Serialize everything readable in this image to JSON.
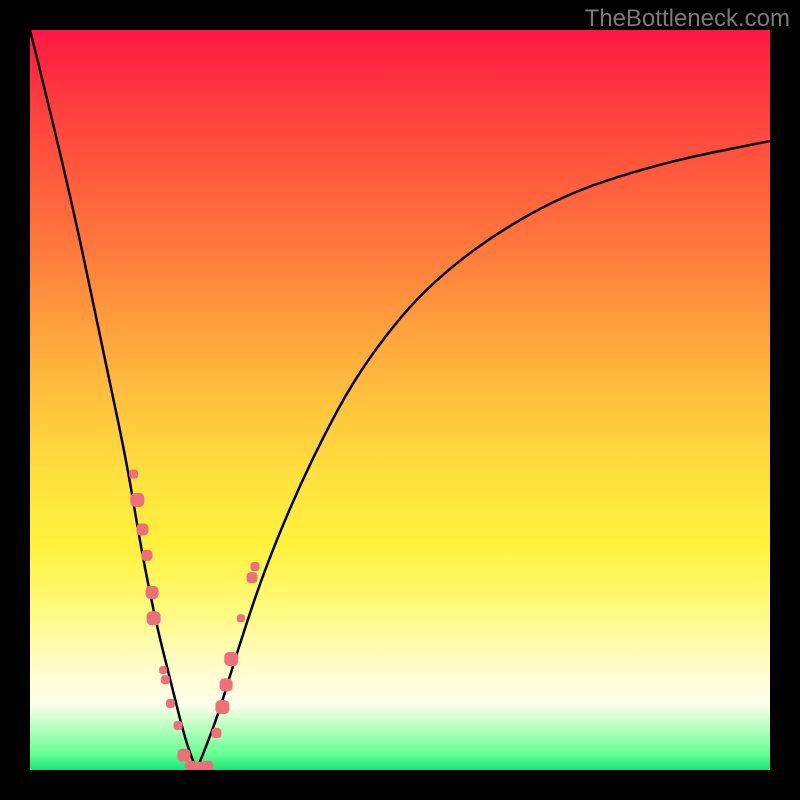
{
  "watermark": "TheBottleneck.com",
  "chart_data": {
    "type": "line",
    "title": "",
    "xlabel": "",
    "ylabel": "",
    "description": "V-shaped bottleneck curve with minimum near x=0.225 (normalized), representing optimal hardware matching where bottleneck approaches zero. Background gradient from red (high bottleneck) at top through yellow to green (low bottleneck) at bottom.",
    "curve": {
      "left_branch": [
        {
          "x": 0.0,
          "y": 1.0
        },
        {
          "x": 0.05,
          "y": 0.8
        },
        {
          "x": 0.1,
          "y": 0.56
        },
        {
          "x": 0.13,
          "y": 0.42
        },
        {
          "x": 0.15,
          "y": 0.3
        },
        {
          "x": 0.17,
          "y": 0.2
        },
        {
          "x": 0.19,
          "y": 0.12
        },
        {
          "x": 0.21,
          "y": 0.04
        },
        {
          "x": 0.225,
          "y": 0.0
        }
      ],
      "right_branch": [
        {
          "x": 0.225,
          "y": 0.0
        },
        {
          "x": 0.25,
          "y": 0.06
        },
        {
          "x": 0.28,
          "y": 0.16
        },
        {
          "x": 0.32,
          "y": 0.28
        },
        {
          "x": 0.38,
          "y": 0.42
        },
        {
          "x": 0.45,
          "y": 0.55
        },
        {
          "x": 0.55,
          "y": 0.67
        },
        {
          "x": 0.7,
          "y": 0.77
        },
        {
          "x": 0.85,
          "y": 0.82
        },
        {
          "x": 1.0,
          "y": 0.85
        }
      ]
    },
    "data_points": [
      {
        "x": 0.14,
        "y": 0.4,
        "size": 9
      },
      {
        "x": 0.145,
        "y": 0.365,
        "size": 14
      },
      {
        "x": 0.152,
        "y": 0.325,
        "size": 12
      },
      {
        "x": 0.158,
        "y": 0.29,
        "size": 11
      },
      {
        "x": 0.165,
        "y": 0.24,
        "size": 13
      },
      {
        "x": 0.167,
        "y": 0.205,
        "size": 14
      },
      {
        "x": 0.18,
        "y": 0.135,
        "size": 8
      },
      {
        "x": 0.183,
        "y": 0.122,
        "size": 9
      },
      {
        "x": 0.19,
        "y": 0.09,
        "size": 9
      },
      {
        "x": 0.2,
        "y": 0.06,
        "size": 9
      },
      {
        "x": 0.208,
        "y": 0.02,
        "size": 13
      },
      {
        "x": 0.217,
        "y": 0.005,
        "size": 11
      },
      {
        "x": 0.23,
        "y": 0.003,
        "size": 12
      },
      {
        "x": 0.24,
        "y": 0.005,
        "size": 11
      },
      {
        "x": 0.252,
        "y": 0.05,
        "size": 10
      },
      {
        "x": 0.26,
        "y": 0.085,
        "size": 14
      },
      {
        "x": 0.265,
        "y": 0.115,
        "size": 13
      },
      {
        "x": 0.272,
        "y": 0.15,
        "size": 14
      },
      {
        "x": 0.285,
        "y": 0.205,
        "size": 8
      },
      {
        "x": 0.3,
        "y": 0.26,
        "size": 11
      },
      {
        "x": 0.304,
        "y": 0.275,
        "size": 9
      }
    ],
    "point_color": "#ed6f79",
    "curve_color": "#000000",
    "ylim": [
      0,
      1
    ],
    "xlim": [
      0,
      1
    ]
  }
}
